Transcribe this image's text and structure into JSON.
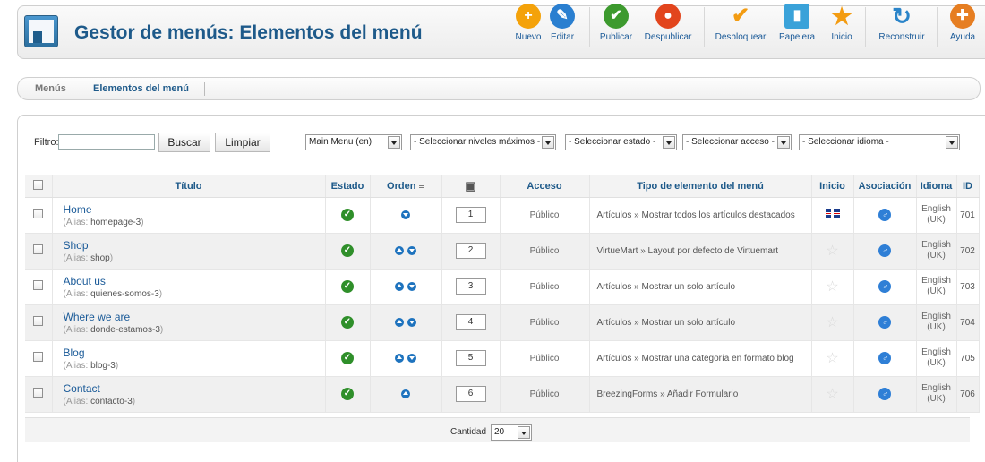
{
  "header": {
    "title": "Gestor de menús: Elementos del menú",
    "toolbar": [
      {
        "label": "Nuevo",
        "icon": "plus-icon",
        "color": "#f4a20a",
        "glyph": "+"
      },
      {
        "label": "Editar",
        "icon": "pencil-icon",
        "color": "#2a7fd0",
        "glyph": "✎"
      },
      {
        "label": "Publicar",
        "icon": "check-icon",
        "color": "#3d9a2e",
        "glyph": "✔"
      },
      {
        "label": "Despublicar",
        "icon": "circle-stop-icon",
        "color": "#e2451d",
        "glyph": "●"
      },
      {
        "label": "Desbloquear",
        "icon": "checkmark-orange-icon",
        "color": "#f39c12",
        "glyph": "✔"
      },
      {
        "label": "Papelera",
        "icon": "trash-icon",
        "color": "#3aa2d9",
        "glyph": "▮"
      },
      {
        "label": "Inicio",
        "icon": "star-icon",
        "color": "#f39c12",
        "glyph": "★"
      },
      {
        "label": "Reconstruir",
        "icon": "refresh-icon",
        "color": "#2a84c9",
        "glyph": "↻"
      },
      {
        "label": "Ayuda",
        "icon": "lifebuoy-icon",
        "color": "#e67e22",
        "glyph": "✚"
      }
    ]
  },
  "submenu": {
    "items": [
      {
        "label": "Menús",
        "active": false
      },
      {
        "label": "Elementos del menú",
        "active": true
      }
    ]
  },
  "filters": {
    "filter_label": "Filtro:",
    "filter_value": "",
    "search_button": "Buscar",
    "clear_button": "Limpiar",
    "menu_select": "Main Menu (en)",
    "levels_select": "- Seleccionar niveles máximos -",
    "state_select": "- Seleccionar estado -",
    "access_select": "- Seleccionar acceso -",
    "language_select": "- Seleccionar idioma -"
  },
  "table": {
    "headers": {
      "title": "Título",
      "state": "Estado",
      "order": "Orden",
      "access": "Acceso",
      "type": "Tipo de elemento del menú",
      "home": "Inicio",
      "association": "Asociación",
      "language": "Idioma",
      "id": "ID"
    },
    "alias_label": "(Alias: ",
    "rows": [
      {
        "title": "Home",
        "alias": "homepage-3",
        "order": "1",
        "access": "Público",
        "type": "Artículos » Mostrar todos los artículos destacados",
        "home": true,
        "lang1": "English",
        "lang2": "(UK)",
        "id": "701",
        "up": false,
        "down": true
      },
      {
        "title": "Shop",
        "alias": "shop",
        "order": "2",
        "access": "Público",
        "type": "VirtueMart » Layout por defecto de Virtuemart",
        "home": false,
        "lang1": "English",
        "lang2": "(UK)",
        "id": "702",
        "up": true,
        "down": true
      },
      {
        "title": "About us",
        "alias": "quienes-somos-3",
        "order": "3",
        "access": "Público",
        "type": "Artículos » Mostrar un solo artículo",
        "home": false,
        "lang1": "English",
        "lang2": "(UK)",
        "id": "703",
        "up": true,
        "down": true
      },
      {
        "title": "Where we are",
        "alias": "donde-estamos-3",
        "order": "4",
        "access": "Público",
        "type": "Artículos » Mostrar un solo artículo",
        "home": false,
        "lang1": "English",
        "lang2": "(UK)",
        "id": "704",
        "up": true,
        "down": true
      },
      {
        "title": "Blog",
        "alias": "blog-3",
        "order": "5",
        "access": "Público",
        "type": "Artículos » Mostrar una categoría en formato blog",
        "home": false,
        "lang1": "English",
        "lang2": "(UK)",
        "id": "705",
        "up": true,
        "down": true
      },
      {
        "title": "Contact",
        "alias": "contacto-3",
        "order": "6",
        "access": "Público",
        "type": "BreezingForms » Añadir Formulario",
        "home": false,
        "lang1": "English",
        "lang2": "(UK)",
        "id": "706",
        "up": true,
        "down": false
      }
    ]
  },
  "footer": {
    "limit_label": "Cantidad",
    "limit_value": "20"
  },
  "colors": {
    "link": "#1a5a98",
    "title": "#1e5a8a",
    "published": "#2f8f2a"
  }
}
